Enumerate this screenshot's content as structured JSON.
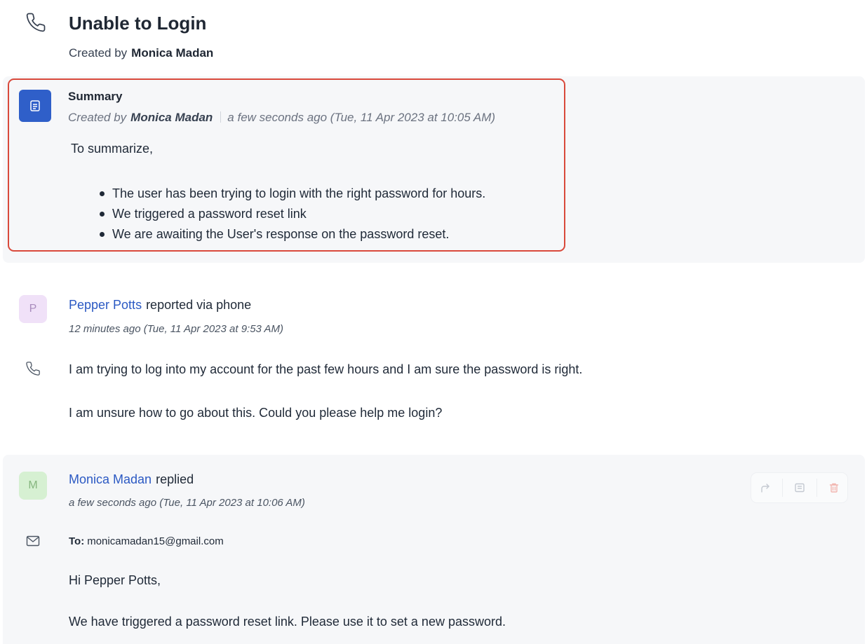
{
  "ticket": {
    "title": "Unable to Login",
    "created_prefix": "Created by",
    "creator": "Monica Madan"
  },
  "summary": {
    "heading": "Summary",
    "meta_prefix": "Created by",
    "author": "Monica Madan",
    "timestamp": "a few seconds ago (Tue, 11 Apr 2023 at 10:05 AM)",
    "intro": "To summarize,",
    "points": [
      "The user has been trying to login with the right password for hours.",
      "We triggered a password reset link",
      "We are awaiting the User's response on the password reset."
    ]
  },
  "conversation": [
    {
      "avatar_letter": "P",
      "author": "Pepper Potts",
      "action": "reported via phone",
      "timestamp": "12 minutes ago (Tue, 11 Apr 2023 at 9:53 AM)",
      "channel_icon": "phone-icon",
      "paragraphs": [
        "I am trying to log into my account for the past few hours and I am sure the password is right.",
        "I am unsure how to go about this. Could you please help me login?"
      ]
    },
    {
      "avatar_letter": "M",
      "author": "Monica Madan",
      "action": "replied",
      "timestamp": "a few seconds ago (Tue, 11 Apr 2023 at 10:06 AM)",
      "channel_icon": "mail-icon",
      "to_label": "To:",
      "to_address": "monicamadan15@gmail.com",
      "actions": [
        "forward-icon",
        "note-icon",
        "delete-icon"
      ],
      "paragraphs": [
        "Hi Pepper Potts,",
        "We have triggered a password reset link. Please use it to set a new password."
      ]
    }
  ],
  "colors": {
    "accent_blue": "#2b59c3",
    "summary_icon_bg": "#2f5fc9",
    "highlight_border": "#d9493b",
    "band_bg": "#f6f7f9"
  }
}
